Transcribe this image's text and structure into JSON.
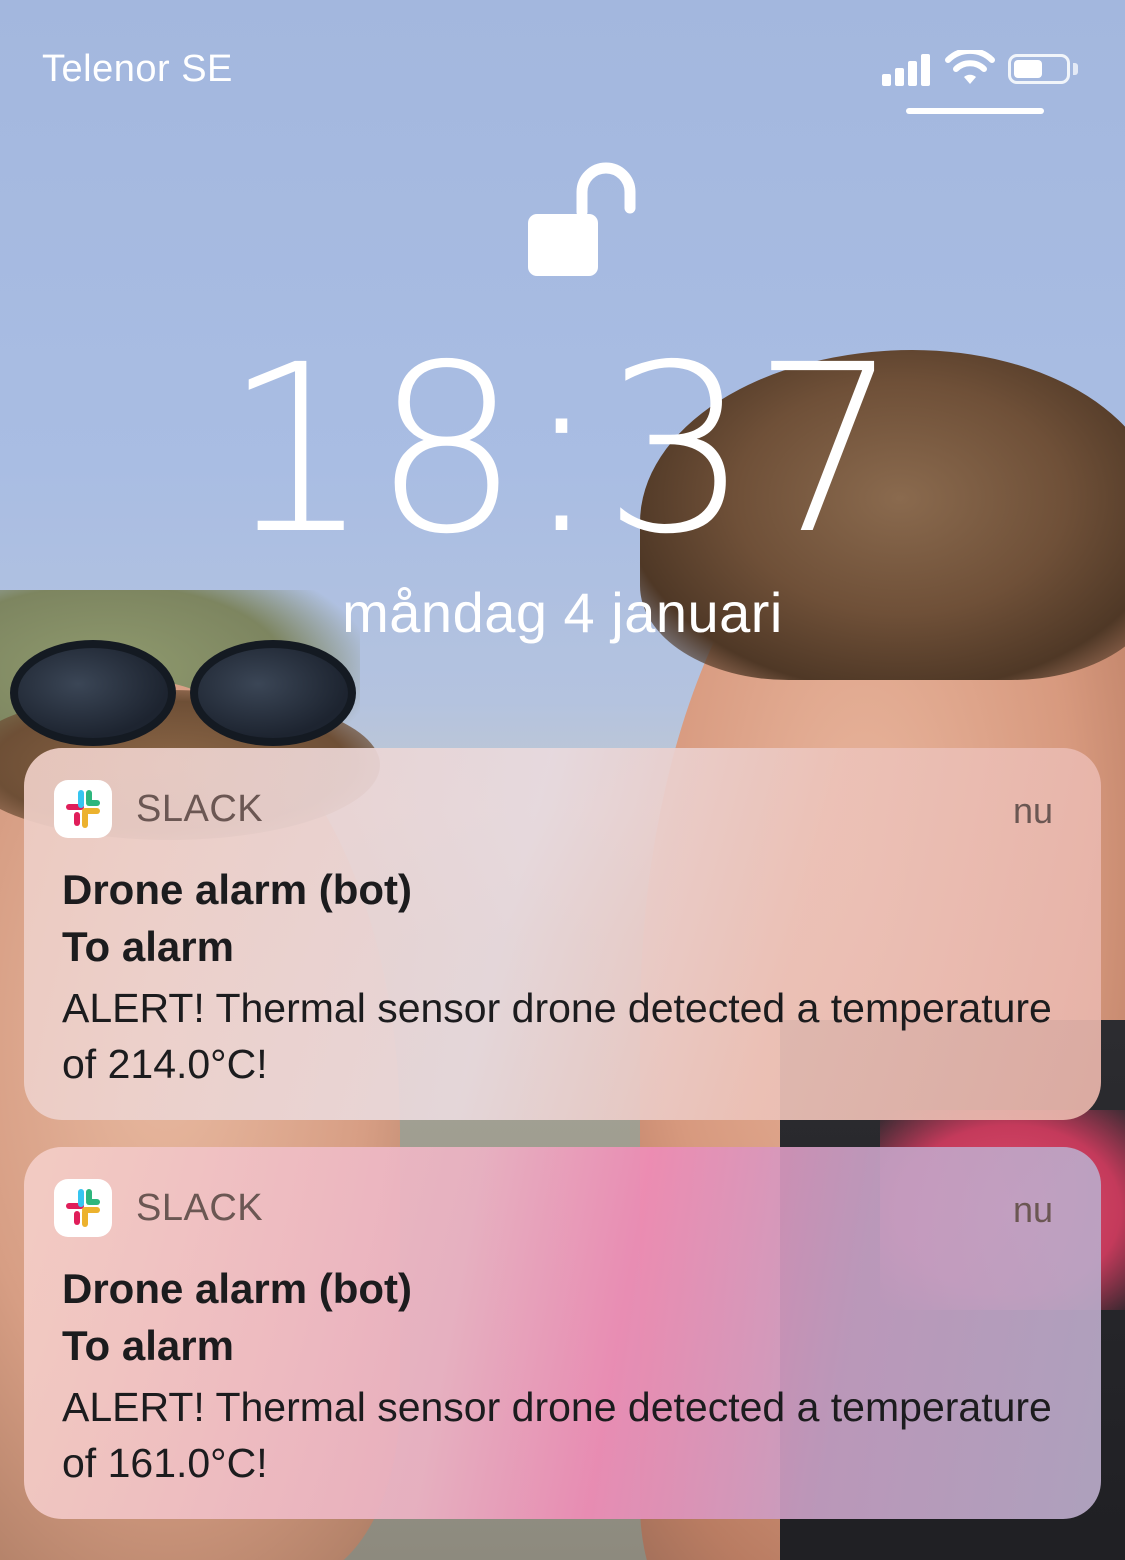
{
  "status_bar": {
    "carrier": "Telenor SE",
    "signal_bars": 4,
    "wifi": "wifi-icon",
    "battery_level": 0.55
  },
  "lock": {
    "icon": "unlocked-padlock-icon",
    "time": "18:37",
    "date": "måndag 4 januari"
  },
  "notifications": [
    {
      "app_icon": "slack-logo-icon",
      "app_name": "SLACK",
      "time": "nu",
      "sender": "Drone alarm (bot)",
      "subject": "To alarm",
      "message": "ALERT! Thermal sensor drone detected a temperature of 214.0°C!"
    },
    {
      "app_icon": "slack-logo-icon",
      "app_name": "SLACK",
      "time": "nu",
      "sender": "Drone alarm (bot)",
      "subject": "To alarm",
      "message": "ALERT! Thermal sensor drone detected a temperature of 161.0°C!"
    }
  ]
}
